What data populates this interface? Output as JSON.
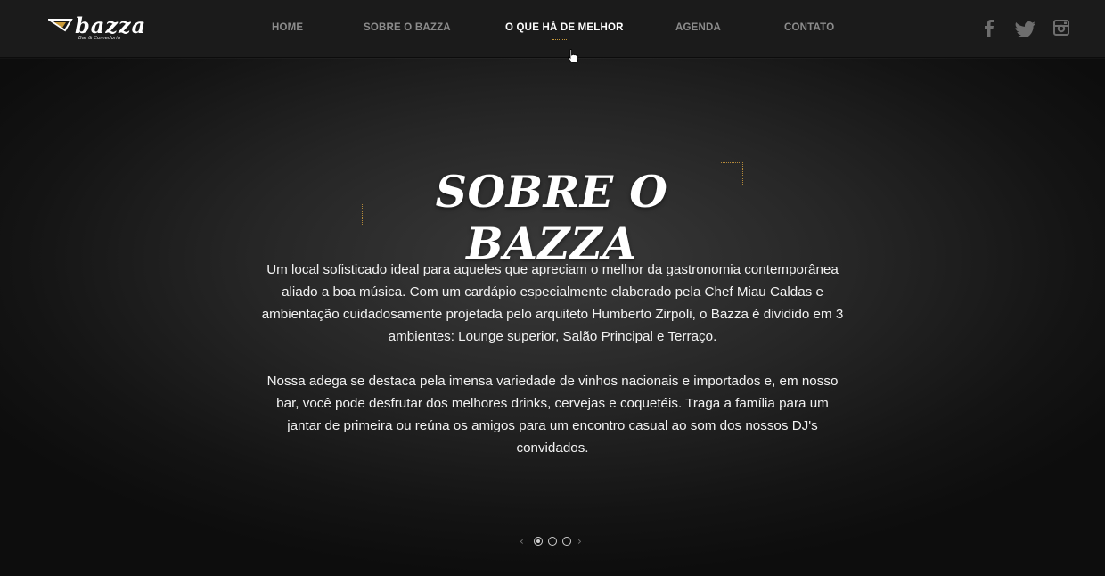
{
  "header": {
    "logo": {
      "brand": "bazza",
      "tagline": "Bar & Comedoria"
    },
    "nav": [
      {
        "label": "HOME"
      },
      {
        "label": "SOBRE O BAZZA"
      },
      {
        "label": "O QUE HÁ DE MELHOR",
        "active": true
      },
      {
        "label": "AGENDA"
      },
      {
        "label": "CONTATO"
      }
    ],
    "social": [
      "facebook-icon",
      "twitter-icon",
      "instagram-icon"
    ]
  },
  "main": {
    "title": "SOBRE O BAZZA",
    "paragraph1": "Um local sofisticado ideal para aqueles que apreciam o melhor da gastronomia contemporânea aliado a boa música. Com um cardápio especialmente elaborado pela Chef Miau Caldas e ambientação cuidadosamente projetada pelo arquiteto Humberto Zirpoli, o Bazza é dividido em 3 ambientes: Lounge superior, Salão Principal e Terraço.",
    "paragraph2": "Nossa adega se destaca pela imensa variedade de vinhos nacionais e importados e, em nosso bar, você pode desfrutar dos melhores drinks, cervejas e coquetéis. Traga a família para um jantar de primeira ou reúna os amigos para um encontro casual ao som dos nossos DJ's convidados."
  },
  "pager": {
    "total": 3,
    "current": 1
  },
  "colors": {
    "accent": "#c99a3a",
    "nav_inactive": "#8c8c8c",
    "topbar": "#1b1b1b"
  }
}
